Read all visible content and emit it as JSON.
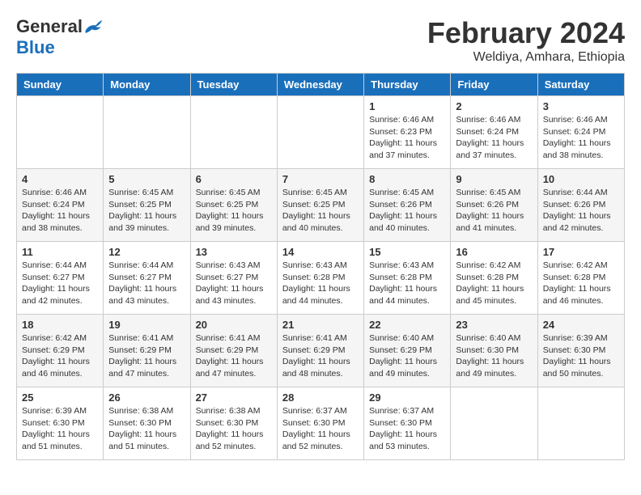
{
  "header": {
    "logo_general": "General",
    "logo_blue": "Blue",
    "month_title": "February 2024",
    "location": "Weldiya, Amhara, Ethiopia"
  },
  "days_of_week": [
    "Sunday",
    "Monday",
    "Tuesday",
    "Wednesday",
    "Thursday",
    "Friday",
    "Saturday"
  ],
  "weeks": [
    [
      {
        "day": "",
        "info": ""
      },
      {
        "day": "",
        "info": ""
      },
      {
        "day": "",
        "info": ""
      },
      {
        "day": "",
        "info": ""
      },
      {
        "day": "1",
        "info": "Sunrise: 6:46 AM\nSunset: 6:23 PM\nDaylight: 11 hours\nand 37 minutes."
      },
      {
        "day": "2",
        "info": "Sunrise: 6:46 AM\nSunset: 6:24 PM\nDaylight: 11 hours\nand 37 minutes."
      },
      {
        "day": "3",
        "info": "Sunrise: 6:46 AM\nSunset: 6:24 PM\nDaylight: 11 hours\nand 38 minutes."
      }
    ],
    [
      {
        "day": "4",
        "info": "Sunrise: 6:46 AM\nSunset: 6:24 PM\nDaylight: 11 hours\nand 38 minutes."
      },
      {
        "day": "5",
        "info": "Sunrise: 6:45 AM\nSunset: 6:25 PM\nDaylight: 11 hours\nand 39 minutes."
      },
      {
        "day": "6",
        "info": "Sunrise: 6:45 AM\nSunset: 6:25 PM\nDaylight: 11 hours\nand 39 minutes."
      },
      {
        "day": "7",
        "info": "Sunrise: 6:45 AM\nSunset: 6:25 PM\nDaylight: 11 hours\nand 40 minutes."
      },
      {
        "day": "8",
        "info": "Sunrise: 6:45 AM\nSunset: 6:26 PM\nDaylight: 11 hours\nand 40 minutes."
      },
      {
        "day": "9",
        "info": "Sunrise: 6:45 AM\nSunset: 6:26 PM\nDaylight: 11 hours\nand 41 minutes."
      },
      {
        "day": "10",
        "info": "Sunrise: 6:44 AM\nSunset: 6:26 PM\nDaylight: 11 hours\nand 42 minutes."
      }
    ],
    [
      {
        "day": "11",
        "info": "Sunrise: 6:44 AM\nSunset: 6:27 PM\nDaylight: 11 hours\nand 42 minutes."
      },
      {
        "day": "12",
        "info": "Sunrise: 6:44 AM\nSunset: 6:27 PM\nDaylight: 11 hours\nand 43 minutes."
      },
      {
        "day": "13",
        "info": "Sunrise: 6:43 AM\nSunset: 6:27 PM\nDaylight: 11 hours\nand 43 minutes."
      },
      {
        "day": "14",
        "info": "Sunrise: 6:43 AM\nSunset: 6:28 PM\nDaylight: 11 hours\nand 44 minutes."
      },
      {
        "day": "15",
        "info": "Sunrise: 6:43 AM\nSunset: 6:28 PM\nDaylight: 11 hours\nand 44 minutes."
      },
      {
        "day": "16",
        "info": "Sunrise: 6:42 AM\nSunset: 6:28 PM\nDaylight: 11 hours\nand 45 minutes."
      },
      {
        "day": "17",
        "info": "Sunrise: 6:42 AM\nSunset: 6:28 PM\nDaylight: 11 hours\nand 46 minutes."
      }
    ],
    [
      {
        "day": "18",
        "info": "Sunrise: 6:42 AM\nSunset: 6:29 PM\nDaylight: 11 hours\nand 46 minutes."
      },
      {
        "day": "19",
        "info": "Sunrise: 6:41 AM\nSunset: 6:29 PM\nDaylight: 11 hours\nand 47 minutes."
      },
      {
        "day": "20",
        "info": "Sunrise: 6:41 AM\nSunset: 6:29 PM\nDaylight: 11 hours\nand 47 minutes."
      },
      {
        "day": "21",
        "info": "Sunrise: 6:41 AM\nSunset: 6:29 PM\nDaylight: 11 hours\nand 48 minutes."
      },
      {
        "day": "22",
        "info": "Sunrise: 6:40 AM\nSunset: 6:29 PM\nDaylight: 11 hours\nand 49 minutes."
      },
      {
        "day": "23",
        "info": "Sunrise: 6:40 AM\nSunset: 6:30 PM\nDaylight: 11 hours\nand 49 minutes."
      },
      {
        "day": "24",
        "info": "Sunrise: 6:39 AM\nSunset: 6:30 PM\nDaylight: 11 hours\nand 50 minutes."
      }
    ],
    [
      {
        "day": "25",
        "info": "Sunrise: 6:39 AM\nSunset: 6:30 PM\nDaylight: 11 hours\nand 51 minutes."
      },
      {
        "day": "26",
        "info": "Sunrise: 6:38 AM\nSunset: 6:30 PM\nDaylight: 11 hours\nand 51 minutes."
      },
      {
        "day": "27",
        "info": "Sunrise: 6:38 AM\nSunset: 6:30 PM\nDaylight: 11 hours\nand 52 minutes."
      },
      {
        "day": "28",
        "info": "Sunrise: 6:37 AM\nSunset: 6:30 PM\nDaylight: 11 hours\nand 52 minutes."
      },
      {
        "day": "29",
        "info": "Sunrise: 6:37 AM\nSunset: 6:30 PM\nDaylight: 11 hours\nand 53 minutes."
      },
      {
        "day": "",
        "info": ""
      },
      {
        "day": "",
        "info": ""
      }
    ]
  ]
}
